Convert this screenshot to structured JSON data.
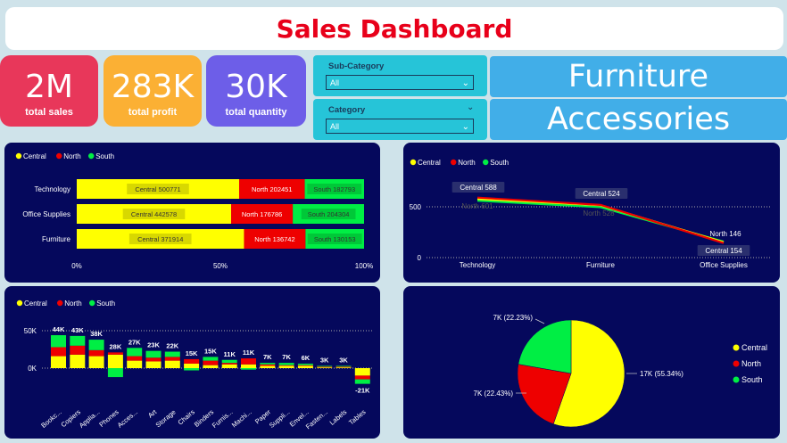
{
  "header": {
    "title": "Sales Dashboard"
  },
  "kpis": [
    {
      "value": "2M",
      "label": "total sales",
      "color": "#e8375a"
    },
    {
      "value": "283K",
      "label": "total profit",
      "color": "#fbb034"
    },
    {
      "value": "30K",
      "label": "total quantity",
      "color": "#6d5ee8"
    }
  ],
  "slicers": {
    "subcategory": {
      "title": "Sub-Category",
      "value": "All"
    },
    "category": {
      "title": "Category",
      "value": "All"
    }
  },
  "cards": {
    "card1": "Furniture",
    "card2": "Accessories"
  },
  "legend": {
    "central": "Central",
    "north": "North",
    "south": "South"
  },
  "colors": {
    "central": "#ffff00",
    "north": "#ee0000",
    "south": "#00ee44",
    "panel": "#05085c"
  },
  "chart_data": [
    {
      "type": "bar",
      "orientation": "horizontal-100%-stacked",
      "categories": [
        "Technology",
        "Office Supplies",
        "Furniture"
      ],
      "series": [
        {
          "name": "Central",
          "values": [
            500771,
            442578,
            371914
          ]
        },
        {
          "name": "North",
          "values": [
            202451,
            176786,
            136742
          ]
        },
        {
          "name": "South",
          "values": [
            182793,
            204304,
            130153
          ]
        }
      ],
      "xticks": [
        "0%",
        "50%",
        "100%"
      ],
      "legend": "top-left"
    },
    {
      "type": "line",
      "categories": [
        "Technology",
        "Furniture",
        "Office Supplies"
      ],
      "series": [
        {
          "name": "Central",
          "values": [
            588,
            524,
            154
          ]
        },
        {
          "name": "North",
          "values": [
            601,
            528,
            146
          ]
        },
        {
          "name": "South",
          "values": [
            570,
            505,
            160
          ]
        }
      ],
      "labels": [
        {
          "text": "Central 588"
        },
        {
          "text": "North 601"
        },
        {
          "text": "Central 524"
        },
        {
          "text": "North 528"
        },
        {
          "text": "North 146"
        },
        {
          "text": "Central 154"
        }
      ],
      "yticks": [
        "0",
        "500"
      ],
      "ylim": [
        0,
        700
      ],
      "legend": "top-left"
    },
    {
      "type": "bar",
      "orientation": "vertical-stacked",
      "categories": [
        "Bookc...",
        "Copiers",
        "Applia...",
        "Phones",
        "Acces...",
        "Art",
        "Storage",
        "Chairs",
        "Binders",
        "Furnis...",
        "Machi...",
        "Paper",
        "Suppli...",
        "Envel...",
        "Fasten...",
        "Labels",
        "Tables"
      ],
      "totals": [
        "44K",
        "43K",
        "38K",
        "28K",
        "27K",
        "23K",
        "22K",
        "15K",
        "15K",
        "11K",
        "11K",
        "7K",
        "7K",
        "6K",
        "3K",
        "3K",
        "-21K"
      ],
      "series": [
        {
          "name": "Central",
          "values": [
            16,
            18,
            16,
            18,
            10,
            9,
            10,
            6,
            4,
            5,
            5,
            3,
            3,
            3,
            1,
            1,
            -10
          ]
        },
        {
          "name": "North",
          "values": [
            12,
            12,
            8,
            3,
            6,
            5,
            5,
            6,
            6,
            2,
            8,
            2,
            1,
            1,
            1,
            1,
            -5
          ]
        },
        {
          "name": "South",
          "values": [
            16,
            13,
            14,
            -12,
            11,
            9,
            7,
            -3,
            5,
            4,
            -2,
            2,
            3,
            2,
            1,
            1,
            -6
          ]
        }
      ],
      "yticks": [
        "0K",
        "50K"
      ],
      "ylim": [
        -25,
        55
      ],
      "legend": "top-left"
    },
    {
      "type": "pie",
      "slices": [
        {
          "name": "Central",
          "value": 55.34,
          "label": "17K (55.34%)"
        },
        {
          "name": "North",
          "value": 22.43,
          "label": "7K (22.43%)"
        },
        {
          "name": "South",
          "value": 22.23,
          "label": "7K (22.23%)"
        }
      ],
      "legend": "right"
    }
  ]
}
